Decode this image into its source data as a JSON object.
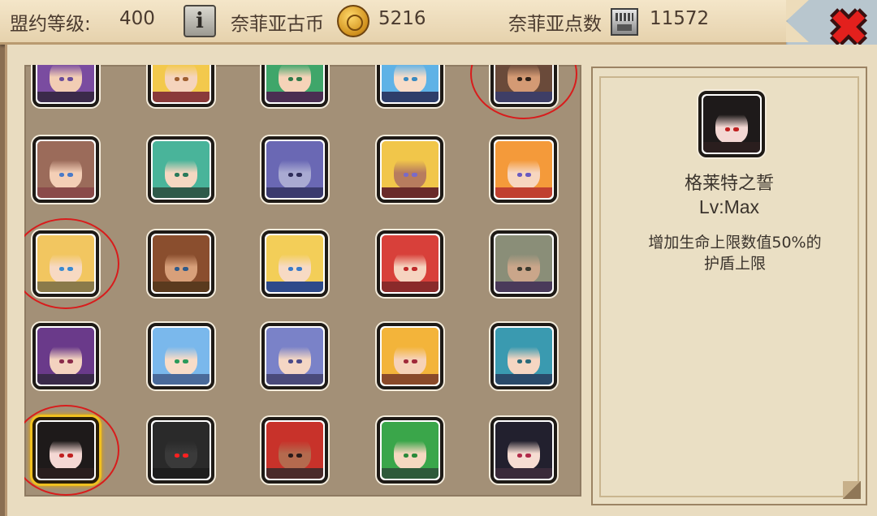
{
  "resources": {
    "alliance_level_label": "盟约等级:",
    "alliance_level_value": "400",
    "coin_label": "奈菲亚古币",
    "coin_value": "5216",
    "points_label": "奈菲亚点数",
    "points_value": "11572"
  },
  "icons": {
    "info": "info-icon",
    "coin": "coin-icon",
    "points": "memory-card-icon",
    "close": "close-icon"
  },
  "info_glyph": "i",
  "close_glyph": "✖",
  "colors": {
    "close_red": "#e3201d",
    "selected_border": "#f0c020",
    "annotation_circle": "#d81c1c"
  },
  "portraits": [
    {
      "hair": "#7a4ca0",
      "skin": "#f2cdb4",
      "eye": "#6a4c9a",
      "collar": "#3b2a4a",
      "state": "normal"
    },
    {
      "hair": "#f3c94c",
      "skin": "#f5d4bd",
      "eye": "#a06030",
      "collar": "#8a3a3a",
      "state": "normal"
    },
    {
      "hair": "#3fa66a",
      "skin": "#f5d3b8",
      "eye": "#2f7a4a",
      "collar": "#4a2e52",
      "state": "normal"
    },
    {
      "hair": "#5fb2e6",
      "skin": "#f7dcc8",
      "eye": "#3a8ac0",
      "collar": "#2e3e6a",
      "state": "normal"
    },
    {
      "hair": "#6a4a3a",
      "skin": "#d49a74",
      "eye": "#2e2018",
      "collar": "#3e3e66",
      "state": "annotated"
    },
    {
      "hair": "#9b6b5a",
      "skin": "#f4cfb6",
      "eye": "#4a7ac8",
      "collar": "#8a4a4a",
      "state": "normal"
    },
    {
      "hair": "#49b49a",
      "skin": "#f5d7c1",
      "eye": "#2a7a5a",
      "collar": "#2e5a4a",
      "state": "normal"
    },
    {
      "hair": "#6a68b4",
      "skin": "#a9aad2",
      "eye": "#2e2c5a",
      "collar": "#3a3a6e",
      "state": "normal"
    },
    {
      "hair": "#f1c64a",
      "skin": "#b77c5e",
      "eye": "#7a6ac8",
      "collar": "#6a2a2a",
      "state": "normal"
    },
    {
      "hair": "#f49a3a",
      "skin": "#f7d6bf",
      "eye": "#6a5ac0",
      "collar": "#c04030",
      "state": "normal"
    },
    {
      "hair": "#f2c660",
      "skin": "#f7d9c2",
      "eye": "#3a8ad0",
      "collar": "#8a7a4a",
      "state": "annotated"
    },
    {
      "hair": "#8a4e2e",
      "skin": "#d8a07a",
      "eye": "#2e5a8a",
      "collar": "#5a3a1e",
      "state": "normal"
    },
    {
      "hair": "#f3ce58",
      "skin": "#f7dac4",
      "eye": "#3a7ac8",
      "collar": "#2e4a8a",
      "state": "normal"
    },
    {
      "hair": "#d8403a",
      "skin": "#f6d4c0",
      "eye": "#c02a2a",
      "collar": "#8a2a2a",
      "state": "normal"
    },
    {
      "hair": "#8a8e78",
      "skin": "#caa68a",
      "eye": "#3a3a2e",
      "collar": "#4a3a5a",
      "state": "normal"
    },
    {
      "hair": "#6a3a8a",
      "skin": "#f3d2bf",
      "eye": "#8a2a4a",
      "collar": "#3a2a4a",
      "state": "normal"
    },
    {
      "hair": "#7ab8ec",
      "skin": "#f7dcc8",
      "eye": "#2a9a5a",
      "collar": "#4a6a9a",
      "state": "normal"
    },
    {
      "hair": "#7a82c8",
      "skin": "#f4d6c4",
      "eye": "#4a4a8a",
      "collar": "#4a4a7a",
      "state": "normal"
    },
    {
      "hair": "#f3b43a",
      "skin": "#f6d2b8",
      "eye": "#a02a3a",
      "collar": "#8a4a2a",
      "state": "normal"
    },
    {
      "hair": "#3a9ab0",
      "skin": "#f5d6c2",
      "eye": "#2a6a7a",
      "collar": "#2a4a6a",
      "state": "normal"
    },
    {
      "hair": "#1e1a1a",
      "skin": "#f4d8d4",
      "eye": "#c02020",
      "collar": "#2a1e1e",
      "state": "selected"
    },
    {
      "hair": "#2a2a2a",
      "skin": "#3a3a3a",
      "eye": "#ff2020",
      "collar": "#1e1e1e",
      "state": "normal"
    },
    {
      "hair": "#c8322a",
      "skin": "#b46a4e",
      "eye": "#2a1a1a",
      "collar": "#4a2a2a",
      "state": "normal"
    },
    {
      "hair": "#3aa64a",
      "skin": "#f5d8c0",
      "eye": "#2a8a3a",
      "collar": "#2e5a3a",
      "state": "normal"
    },
    {
      "hair": "#22202e",
      "skin": "#f6dcd2",
      "eye": "#b02a4a",
      "collar": "#3a2a3a",
      "state": "normal"
    }
  ],
  "detail": {
    "name": "格莱特之誓",
    "level": "Lv:Max",
    "description_line1": "增加生命上限数值50%的",
    "description_line2": "护盾上限",
    "portrait": {
      "hair": "#1e1a1a",
      "skin": "#f4d8d4",
      "eye": "#c02020",
      "collar": "#2a1e1e"
    }
  }
}
